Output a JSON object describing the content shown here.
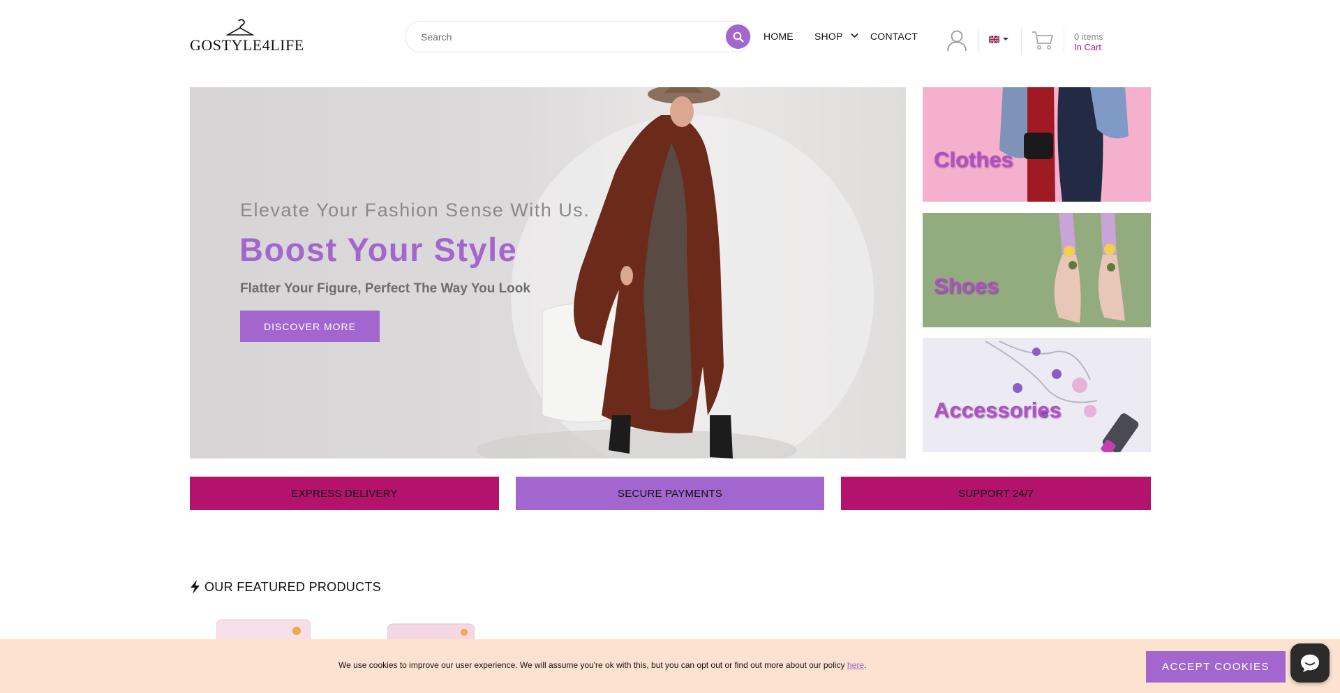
{
  "header": {
    "logo_text": "GOSTYLE4LIFE",
    "search_placeholder": "Search",
    "nav": {
      "home": "HOME",
      "shop": "SHOP",
      "contact": "CONTACT"
    },
    "cart": {
      "items": "0 items",
      "label": "In Cart"
    },
    "language_flag": "uk-flag-icon"
  },
  "hero": {
    "subtitle": "Elevate Your Fashion Sense With Us.",
    "title": "Boost Your Style",
    "description": "Flatter Your Figure, Perfect The Way You Look",
    "button": "DISCOVER MORE"
  },
  "categories": [
    {
      "label": "Clothes"
    },
    {
      "label": "Shoes"
    },
    {
      "label": "Accessories"
    }
  ],
  "features": [
    {
      "label": "EXPRESS DELIVERY",
      "color": "#b3126d"
    },
    {
      "label": "SECURE PAYMENTS",
      "color": "#a366cf"
    },
    {
      "label": "SUPPORT 24/7",
      "color": "#b3126d"
    }
  ],
  "featured": {
    "title": "OUR FEATURED PRODUCTS"
  },
  "cookie": {
    "text": "We use cookies to improve our user experience. We will assume you're ok with this, but you can opt out or find out more about our policy ",
    "link": "here",
    "end": ".",
    "button": "ACCEPT COOKIES"
  },
  "colors": {
    "accent": "#a366cf",
    "brand": "#b3126d"
  }
}
